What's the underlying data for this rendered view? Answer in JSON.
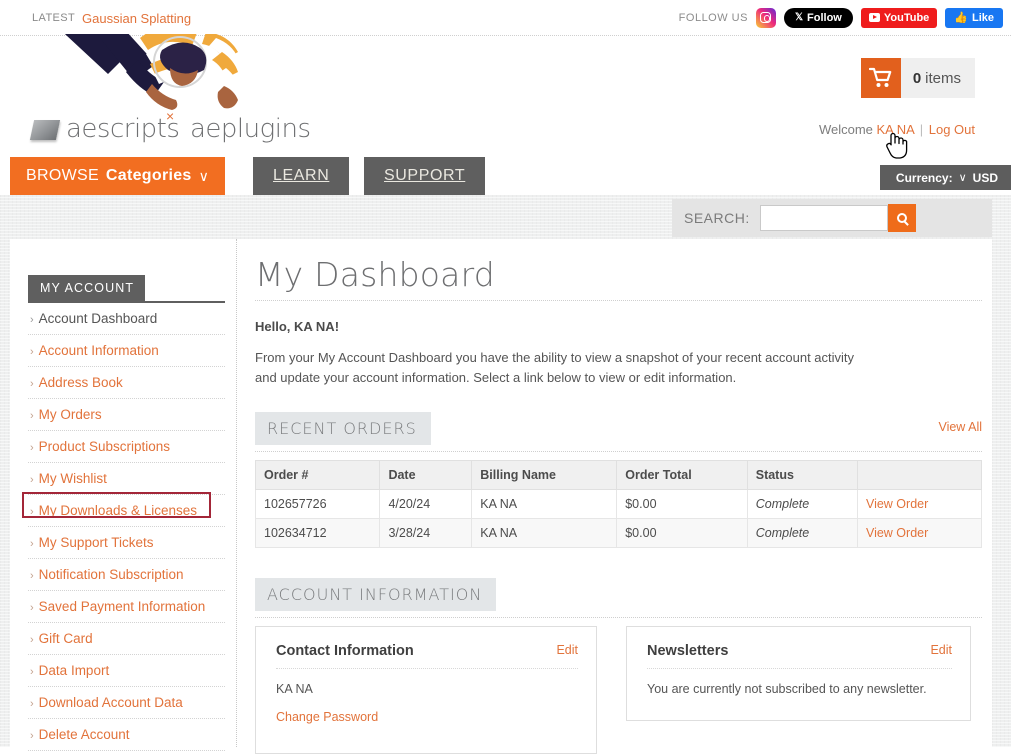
{
  "topbar": {
    "latest_label": "LATEST",
    "latest_link": "Gaussian Splatting",
    "follow_label": "FOLLOW US",
    "instagram_icon": "instagram-icon",
    "x_button": "Follow",
    "youtube_button": "YouTube",
    "facebook_button": "Like"
  },
  "logo": {
    "word_one": "aescripts",
    "word_two": "aeplugins",
    "separator": "×"
  },
  "cart": {
    "icon": "shopping-cart-icon",
    "count": "0",
    "label": "items"
  },
  "account_bar": {
    "welcome_prefix": "Welcome",
    "user_name": "KA NA",
    "separator": "|",
    "logout": "Log Out"
  },
  "nav": {
    "browse_light": "BROWSE",
    "browse_bold": "Categories",
    "browse_caret": "∨",
    "tabs": [
      {
        "label": "LEARN"
      },
      {
        "label": "SUPPORT"
      }
    ]
  },
  "currency": {
    "label": "Currency:",
    "caret": "∨",
    "value": "USD"
  },
  "search": {
    "label": "SEARCH:",
    "value": "",
    "placeholder": "",
    "button_icon": "search-icon"
  },
  "sidebar": {
    "title": "MY ACCOUNT",
    "chevron": "›",
    "items": [
      {
        "label": "Account Dashboard",
        "active": true
      },
      {
        "label": "Account Information",
        "active": false
      },
      {
        "label": "Address Book",
        "active": false
      },
      {
        "label": "My Orders",
        "active": false
      },
      {
        "label": "Product Subscriptions",
        "active": false
      },
      {
        "label": "My Wishlist",
        "active": false
      },
      {
        "label": "My Downloads & Licenses",
        "active": false,
        "highlighted": true
      },
      {
        "label": "My Support Tickets",
        "active": false
      },
      {
        "label": "Notification Subscription",
        "active": false
      },
      {
        "label": "Saved Payment Information",
        "active": false
      },
      {
        "label": "Gift Card",
        "active": false
      },
      {
        "label": "Data Import",
        "active": false
      },
      {
        "label": "Download Account Data",
        "active": false
      },
      {
        "label": "Delete Account",
        "active": false
      }
    ],
    "highlight_color": "#a32638"
  },
  "main": {
    "page_title": "My Dashboard",
    "hello": "Hello, KA NA!",
    "intro": "From your My Account Dashboard you have the ability to view a snapshot of your recent account activity and update your account information. Select a link below to view or edit information.",
    "recent_orders": {
      "heading": "RECENT ORDERS",
      "view_all": "View All",
      "columns": [
        "Order #",
        "Date",
        "Billing Name",
        "Order Total",
        "Status",
        ""
      ],
      "rows": [
        {
          "order": "102657726",
          "date": "4/20/24",
          "billing_name": "KA NA",
          "total": "$0.00",
          "status": "Complete",
          "action": "View Order"
        },
        {
          "order": "102634712",
          "date": "3/28/24",
          "billing_name": "KA NA",
          "total": "$0.00",
          "status": "Complete",
          "action": "View Order"
        }
      ]
    },
    "account_information": {
      "heading": "ACCOUNT INFORMATION",
      "contact": {
        "title": "Contact Information",
        "edit": "Edit",
        "name": "KA NA",
        "change_password": "Change Password"
      },
      "newsletters": {
        "title": "Newsletters",
        "edit": "Edit",
        "text": "You are currently not subscribed to any newsletter."
      }
    }
  },
  "colors": {
    "accent_orange": "#e2733b",
    "brand_orange": "#f26e21",
    "nav_gray": "#5f5f5f",
    "highlight_red": "#a32638"
  }
}
